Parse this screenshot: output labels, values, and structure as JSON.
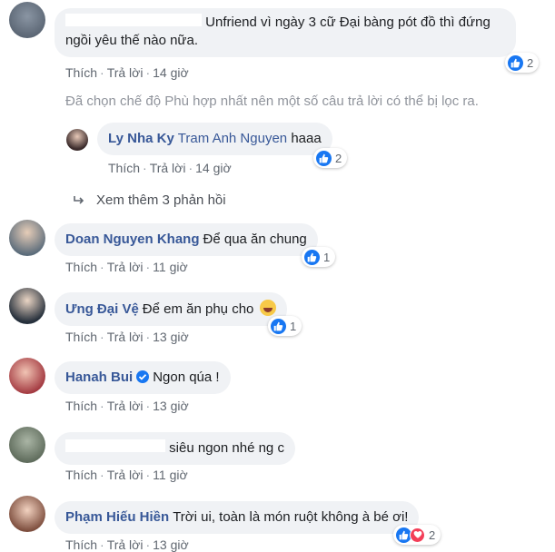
{
  "comments": [
    {
      "author": "",
      "text_line1": "Unfriend vì ngày 3 cữ Đại bàng pót đồ thì đứng",
      "text_line2": "ngồi yêu thế nào nữa.",
      "like_label": "Thích",
      "reply_label": "Trả lời",
      "time": "14 giờ",
      "reaction_count": "2"
    },
    {
      "author": "Ly Nha Ky",
      "mention": "Tram Anh Nguyen",
      "text": "haaa",
      "like_label": "Thích",
      "reply_label": "Trả lời",
      "time": "14 giờ",
      "reaction_count": "2"
    },
    {
      "author": "Doan Nguyen Khang",
      "text": "Để qua ăn chung",
      "like_label": "Thích",
      "reply_label": "Trả lời",
      "time": "11 giờ",
      "reaction_count": "1"
    },
    {
      "author": "Ưng Đại Vệ",
      "text": "Để em ăn phụ cho",
      "like_label": "Thích",
      "reply_label": "Trả lời",
      "time": "13 giờ",
      "reaction_count": "1"
    },
    {
      "author": "Hanah Bui",
      "text": "Ngon qúa !",
      "like_label": "Thích",
      "reply_label": "Trả lời",
      "time": "13 giờ"
    },
    {
      "author": "",
      "text": "siêu ngon nhé ng c",
      "like_label": "Thích",
      "reply_label": "Trả lời",
      "time": "11 giờ"
    },
    {
      "author": "Phạm Hiếu Hiền",
      "text": "Trời ui, toàn là món ruột không à bé ơi!",
      "like_label": "Thích",
      "reply_label": "Trả lời",
      "time": "13 giờ",
      "reaction_count": "2"
    }
  ],
  "filter_note": "Đã chọn chế độ Phù hợp nhất nên một số câu trả lời có thể bị lọc ra.",
  "more_replies": "Xem thêm 3 phản hồi",
  "separator": "·",
  "colors": {
    "link": "#385898",
    "bubble": "#f0f2f5",
    "like_blue": "#1877f2",
    "love_red": "#f33e58",
    "meta_gray": "#606770"
  }
}
